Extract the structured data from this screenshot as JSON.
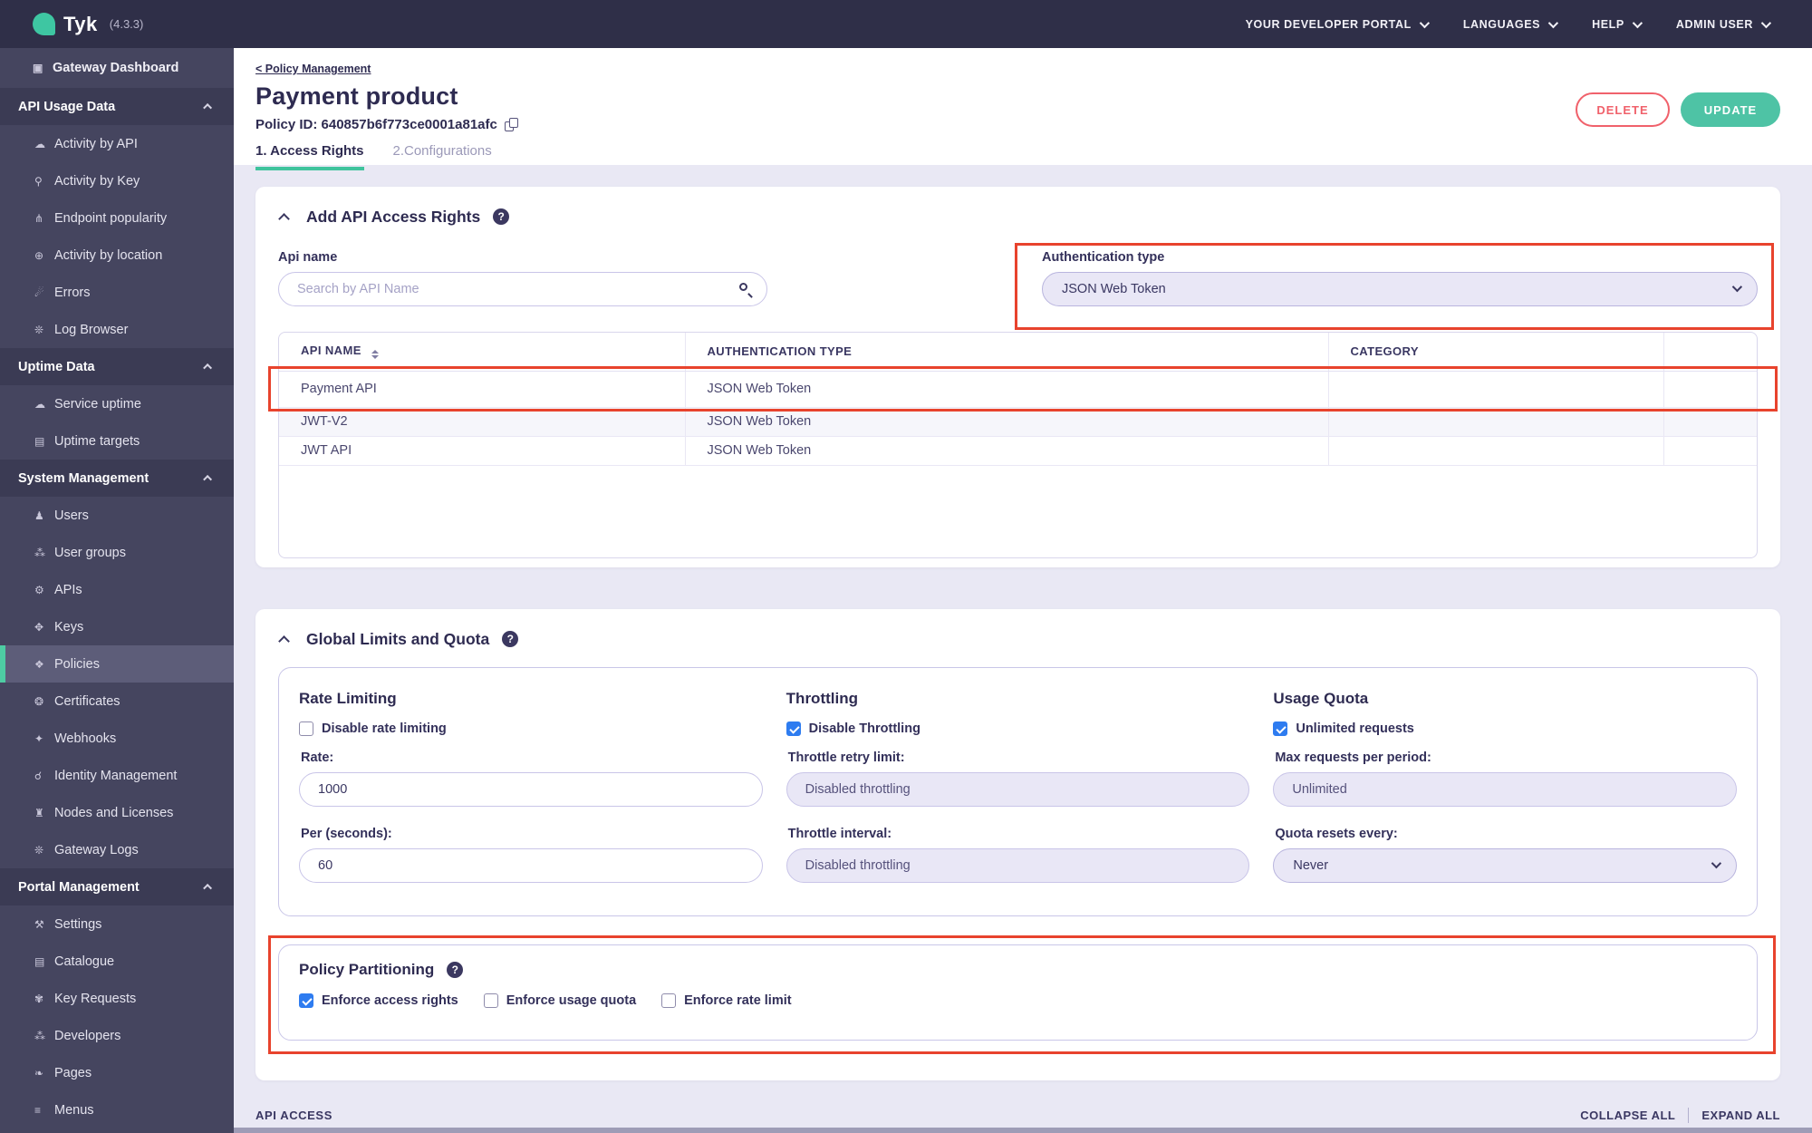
{
  "topbar": {
    "logo_text": "Tyk",
    "version": "(4.3.3)",
    "menus": [
      "YOUR DEVELOPER PORTAL",
      "LANGUAGES",
      "HELP",
      "ADMIN USER"
    ]
  },
  "sidebar": {
    "items": [
      {
        "type": "dash",
        "label": "Gateway Dashboard",
        "icon": "monitor-icon"
      },
      {
        "type": "section",
        "label": "API Usage Data"
      },
      {
        "type": "item",
        "label": "Activity by API",
        "icon": "cloud-icon"
      },
      {
        "type": "item",
        "label": "Activity by Key",
        "icon": "key-icon"
      },
      {
        "type": "item",
        "label": "Endpoint popularity",
        "icon": "fork-icon"
      },
      {
        "type": "item",
        "label": "Activity by location",
        "icon": "globe-icon"
      },
      {
        "type": "item",
        "label": "Errors",
        "icon": "bomb-icon"
      },
      {
        "type": "item",
        "label": "Log Browser",
        "icon": "bug-icon"
      },
      {
        "type": "section",
        "label": "Uptime Data"
      },
      {
        "type": "item",
        "label": "Service uptime",
        "icon": "cloud-icon"
      },
      {
        "type": "item",
        "label": "Uptime targets",
        "icon": "list-icon"
      },
      {
        "type": "section",
        "label": "System Management"
      },
      {
        "type": "item",
        "label": "Users",
        "icon": "user-icon"
      },
      {
        "type": "item",
        "label": "User groups",
        "icon": "users-icon"
      },
      {
        "type": "item",
        "label": "APIs",
        "icon": "gears-icon"
      },
      {
        "type": "item",
        "label": "Keys",
        "icon": "nodes-icon"
      },
      {
        "type": "item",
        "label": "Policies",
        "icon": "layers-icon",
        "active": true
      },
      {
        "type": "item",
        "label": "Certificates",
        "icon": "seal-icon"
      },
      {
        "type": "item",
        "label": "Webhooks",
        "icon": "bell-icon"
      },
      {
        "type": "item",
        "label": "Identity Management",
        "icon": "hook-icon"
      },
      {
        "type": "item",
        "label": "Nodes and Licenses",
        "icon": "bank-icon"
      },
      {
        "type": "item",
        "label": "Gateway Logs",
        "icon": "bug-icon"
      },
      {
        "type": "section",
        "label": "Portal Management"
      },
      {
        "type": "item",
        "label": "Settings",
        "icon": "wrench-icon"
      },
      {
        "type": "item",
        "label": "Catalogue",
        "icon": "catalogue-icon"
      },
      {
        "type": "item",
        "label": "Key Requests",
        "icon": "paw-icon"
      },
      {
        "type": "item",
        "label": "Developers",
        "icon": "group-icon"
      },
      {
        "type": "item",
        "label": "Pages",
        "icon": "leaf-icon"
      },
      {
        "type": "item",
        "label": "Menus",
        "icon": "menu-icon"
      }
    ]
  },
  "header": {
    "breadcrumb": "< Policy Management",
    "title": "Payment product",
    "policy_id": "Policy ID: 640857b6f773ce0001a81afc",
    "tabs": [
      "1. Access Rights",
      "2.Configurations"
    ],
    "delete_label": "DELETE",
    "update_label": "UPDATE"
  },
  "access_rights": {
    "section_title": "Add API Access Rights",
    "api_name_label": "Api name",
    "search_placeholder": "Search by API Name",
    "auth_label": "Authentication type",
    "auth_value": "JSON Web Token",
    "table": {
      "headers": [
        "API NAME",
        "AUTHENTICATION TYPE",
        "CATEGORY"
      ],
      "rows": [
        [
          "Payment API",
          "JSON Web Token",
          ""
        ],
        [
          "JWT-V2",
          "JSON Web Token",
          ""
        ],
        [
          "JWT API",
          "JSON Web Token",
          ""
        ]
      ]
    }
  },
  "limits": {
    "section_title": "Global Limits and Quota",
    "rate": {
      "title": "Rate Limiting",
      "checkbox": "Disable rate limiting",
      "checked": false,
      "field1_label": "Rate:",
      "field1_value": "1000",
      "field2_label": "Per (seconds):",
      "field2_value": "60"
    },
    "throttle": {
      "title": "Throttling",
      "checkbox": "Disable Throttling",
      "checked": true,
      "field1_label": "Throttle retry limit:",
      "field1_value": "Disabled throttling",
      "field2_label": "Throttle interval:",
      "field2_value": "Disabled throttling"
    },
    "quota": {
      "title": "Usage Quota",
      "checkbox": "Unlimited requests",
      "checked": true,
      "field1_label": "Max requests per period:",
      "field1_value": "Unlimited",
      "field2_label": "Quota resets every:",
      "field2_value": "Never"
    }
  },
  "partitioning": {
    "title": "Policy Partitioning",
    "checkboxes": [
      {
        "label": "Enforce access rights",
        "checked": true
      },
      {
        "label": "Enforce usage quota",
        "checked": false
      },
      {
        "label": "Enforce rate limit",
        "checked": false
      }
    ]
  },
  "footer": {
    "section_label": "API ACCESS",
    "collapse_label": "COLLAPSE ALL",
    "expand_label": "EXPAND ALL"
  },
  "colors": {
    "accent_teal": "#4EC3A5",
    "annotation_red": "#E8432D",
    "checkbox_blue": "#2E7CF0",
    "delete_red": "#F0616B"
  }
}
